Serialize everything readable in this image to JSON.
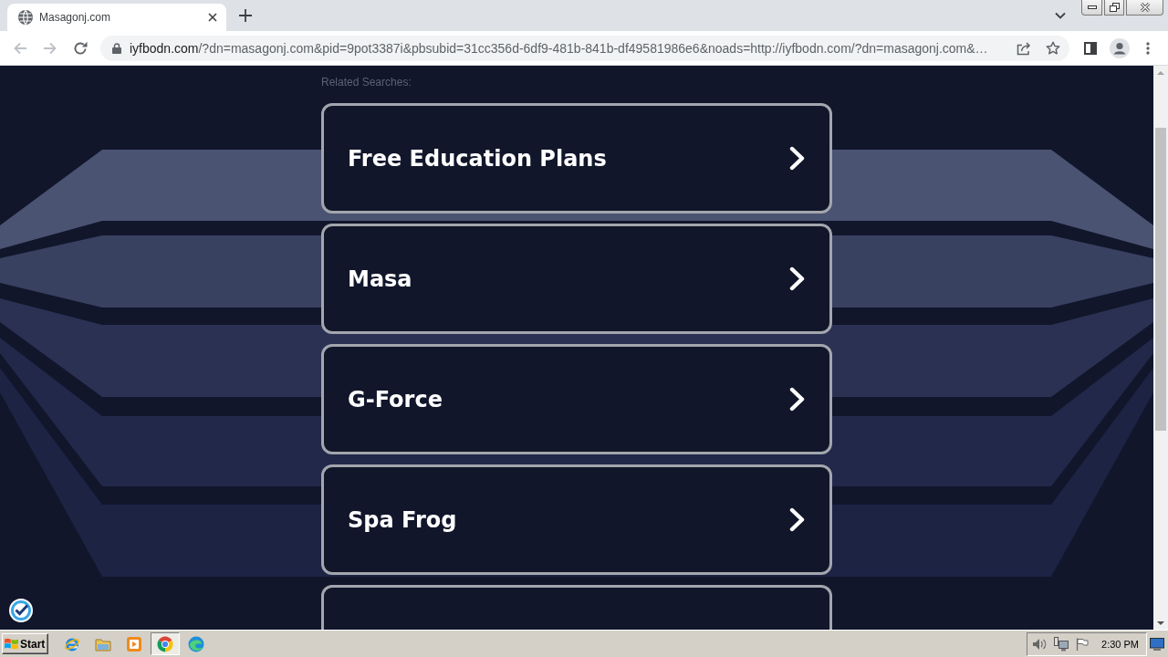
{
  "browser": {
    "tabs": [
      {
        "title": "Masagonj.com",
        "selected": true
      }
    ],
    "navigation": {
      "back": {
        "disabled": true
      },
      "forward": {
        "disabled": true
      }
    },
    "address_bar": {
      "host": "iyfbodn.com",
      "path": "/?dn=masagonj.com&pid=9pot3387i&pbsubid=31cc356d-6df9-481b-841b-df49581986e6&noads=http://iyfbodn.com/?dn=masagonj.com&…"
    }
  },
  "page": {
    "heading": "Related Searches:",
    "results": [
      {
        "kind": "link",
        "label": "Free Education Plans"
      },
      {
        "kind": "link",
        "label": "Masa"
      },
      {
        "kind": "link",
        "label": "G-Force"
      },
      {
        "kind": "link",
        "label": "Spa Frog"
      },
      {
        "kind": "cut_off"
      }
    ]
  },
  "taskbar": {
    "start_label": "Start",
    "apps": [
      {
        "kind": "ie",
        "selected": false
      },
      {
        "kind": "explorer",
        "selected": false
      },
      {
        "kind": "media",
        "selected": false
      },
      {
        "kind": "chrome",
        "selected": true
      },
      {
        "kind": "edge",
        "selected": false
      }
    ],
    "clock": "2:30 PM"
  }
}
